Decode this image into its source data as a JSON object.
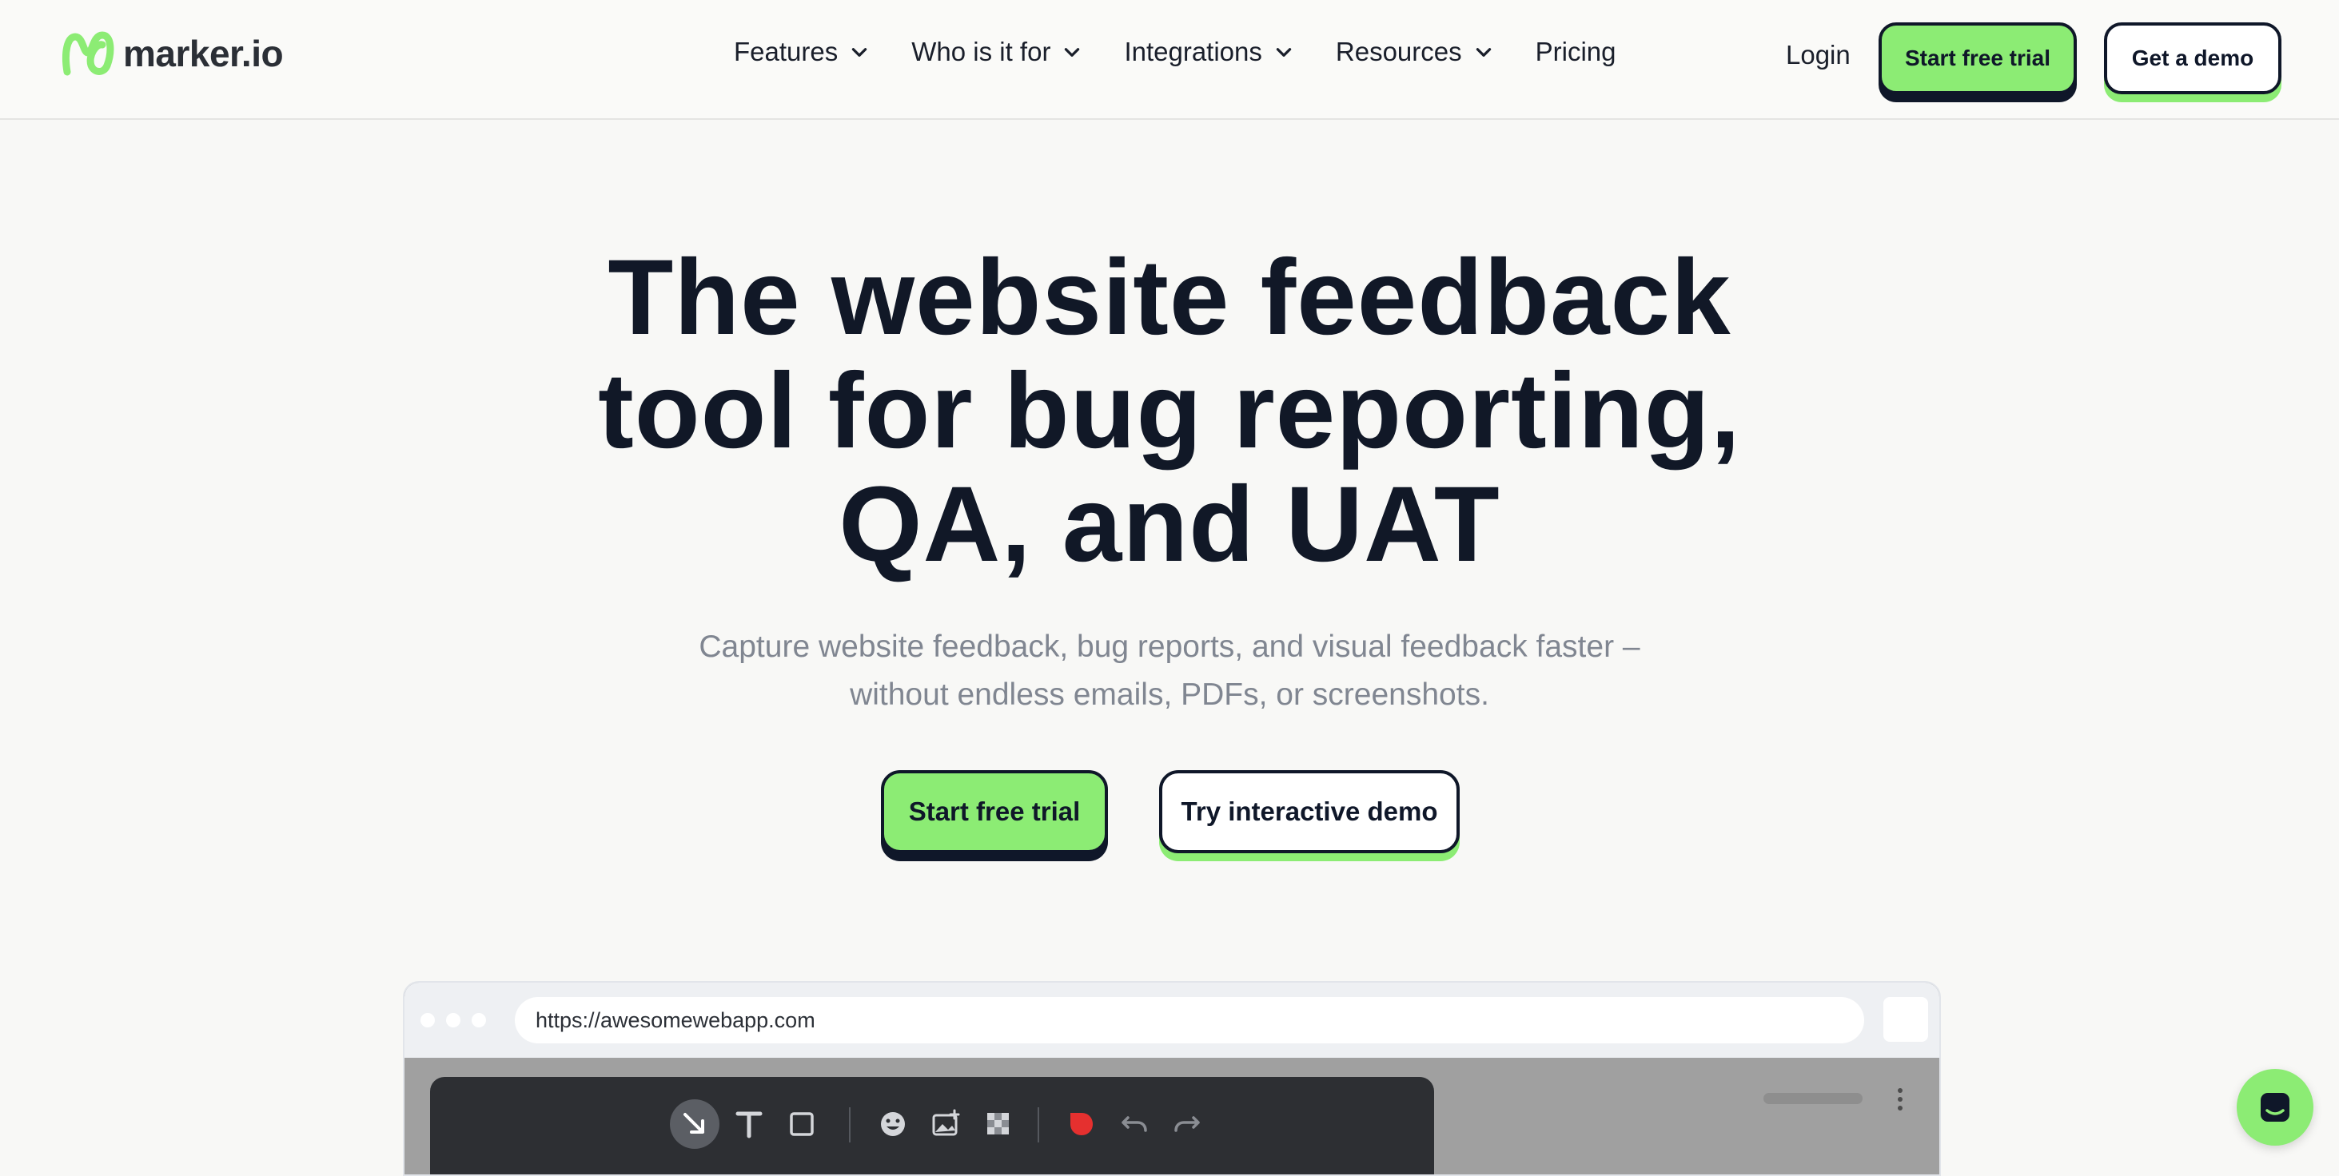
{
  "brand": {
    "name": "marker.io",
    "accent": "#8cec74",
    "ink": "#0f1729"
  },
  "nav": {
    "items": [
      {
        "label": "Features",
        "has_dropdown": true
      },
      {
        "label": "Who is it for",
        "has_dropdown": true
      },
      {
        "label": "Integrations",
        "has_dropdown": true
      },
      {
        "label": "Resources",
        "has_dropdown": true
      },
      {
        "label": "Pricing",
        "has_dropdown": false
      }
    ],
    "login": "Login",
    "start_trial": "Start free trial",
    "get_demo": "Get a demo"
  },
  "hero": {
    "title_lines": [
      "The website feedback",
      "tool for bug reporting,",
      "QA, and UAT"
    ],
    "subtitle_lines": [
      "Capture website feedback, bug reports, and visual feedback faster –",
      "without endless emails, PDFs, or screenshots."
    ],
    "cta_primary": "Start free trial",
    "cta_secondary": "Try interactive demo"
  },
  "mockup": {
    "url": "https://awesomewebapp.com",
    "toolbar_icons": [
      "arrow-tool-icon",
      "text-tool-icon",
      "rectangle-tool-icon",
      "emoji-tool-icon",
      "image-tool-icon",
      "blur-tool-icon",
      "color-picker-icon",
      "undo-icon",
      "redo-icon"
    ],
    "active_tool": "arrow-tool-icon",
    "selected_color": "#e5302f"
  },
  "chat_widget": {
    "icon": "chat-icon"
  }
}
